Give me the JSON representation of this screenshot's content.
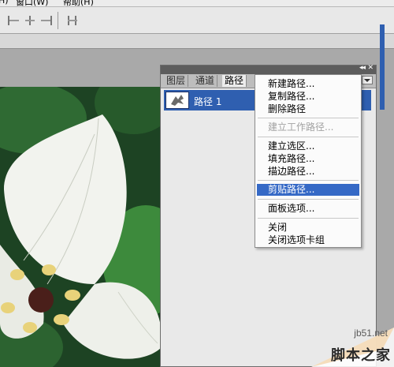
{
  "menubar": {
    "partial_left": "H)",
    "window_menu": "窗口(W)",
    "help_menu": "帮助(H)"
  },
  "paths_panel": {
    "tabs": [
      {
        "label": "图层",
        "active": false
      },
      {
        "label": "通道",
        "active": false
      },
      {
        "label": "路径",
        "active": true
      }
    ],
    "paths": [
      {
        "name": "路径 1",
        "selected": true
      }
    ]
  },
  "context_menu": {
    "items": [
      {
        "label": "新建路径...",
        "disabled": false,
        "highlighted": false
      },
      {
        "label": "复制路径...",
        "disabled": false,
        "highlighted": false
      },
      {
        "label": "删除路径",
        "disabled": false,
        "highlighted": false
      },
      {
        "label": "建立工作路径...",
        "disabled": true,
        "highlighted": false
      },
      {
        "label": "建立选区...",
        "disabled": false,
        "highlighted": false
      },
      {
        "label": "填充路径...",
        "disabled": false,
        "highlighted": false
      },
      {
        "label": "描边路径...",
        "disabled": false,
        "highlighted": false
      },
      {
        "label": "剪贴路径...",
        "disabled": false,
        "highlighted": true
      },
      {
        "label": "面板选项...",
        "disabled": false,
        "highlighted": false
      },
      {
        "label": "关闭",
        "disabled": false,
        "highlighted": false
      },
      {
        "label": "关闭选项卡组",
        "disabled": false,
        "highlighted": false
      }
    ]
  },
  "watermark": {
    "url": "jb51.net",
    "brand": "脚本之家"
  },
  "colors": {
    "selection_blue": "#3569c6",
    "panel_bg": "#d6d6d6",
    "menu_bg": "#fbfbfb"
  }
}
